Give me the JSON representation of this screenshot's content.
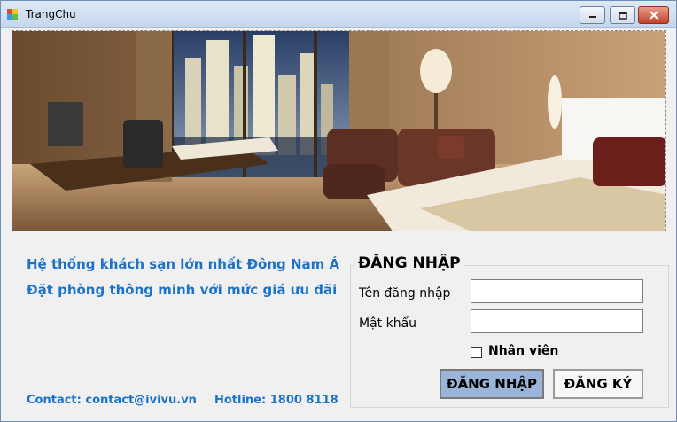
{
  "window": {
    "title": "TrangChu",
    "icon": "app-window-icon",
    "controls": [
      "minimize-icon",
      "maximize-icon",
      "close-icon"
    ]
  },
  "banner": {
    "image": "hotel-room-photo"
  },
  "slogans": {
    "line1": "Hệ thống khách sạn lớn nhất Đông Nam Á",
    "line2": "Đặt phòng thông minh với mức giá ưu đãi"
  },
  "footer": {
    "contact": "Contact: contact@ivivu.vn",
    "hotline": "Hotline: 1800 8118"
  },
  "login": {
    "title": "ĐĂNG NHẬP",
    "username_label": "Tên đăng nhập",
    "username_value": "",
    "password_label": "Mật khẩu",
    "password_value": "",
    "staff_checkbox_label": "Nhân viên",
    "staff_checked": false,
    "login_button": "ĐĂNG NHẬP",
    "register_button": "ĐĂNG KÝ"
  },
  "colors": {
    "accent_text": "#1a73c8",
    "login_button_bg": "#9bb4d9"
  }
}
